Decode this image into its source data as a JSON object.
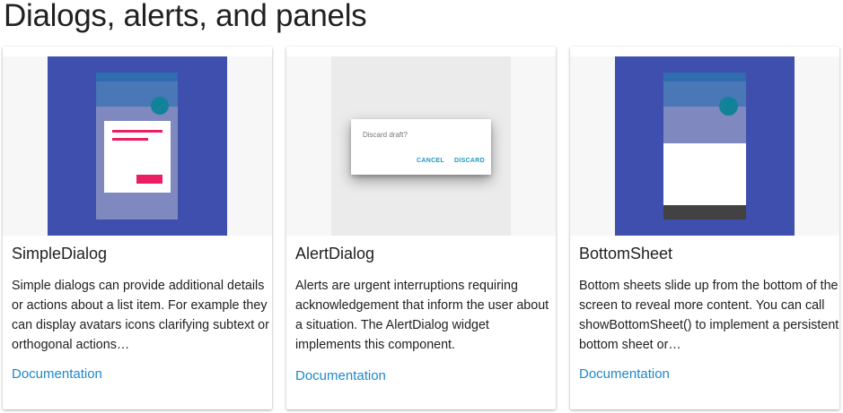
{
  "page": {
    "title": "Dialogs, alerts, and panels"
  },
  "cards": [
    {
      "title": "SimpleDialog",
      "description": "Simple dialogs can provide additional details or actions about a list item. For example they can display avatars icons clarifying subtext or orthogonal actions…",
      "link": "Documentation"
    },
    {
      "title": "AlertDialog",
      "description": "Alerts are urgent interruptions requiring acknowledgement that inform the user about a situation. The AlertDialog widget implements this component.",
      "link": "Documentation",
      "illustration": {
        "dialog_text": "Discard draft?",
        "cancel_label": "CANCEL",
        "discard_label": "DISCARD"
      }
    },
    {
      "title": "BottomSheet",
      "description": "Bottom sheets slide up from the bottom of the screen to reveal more content. You can call showBottomSheet() to implement a persistent bottom sheet or…",
      "link": "Documentation"
    }
  ],
  "colors": {
    "illustration_background": "#3f4fad",
    "accent_pink": "#e91e63",
    "fab_teal": "#11829a",
    "link_blue": "#1e88c7"
  }
}
